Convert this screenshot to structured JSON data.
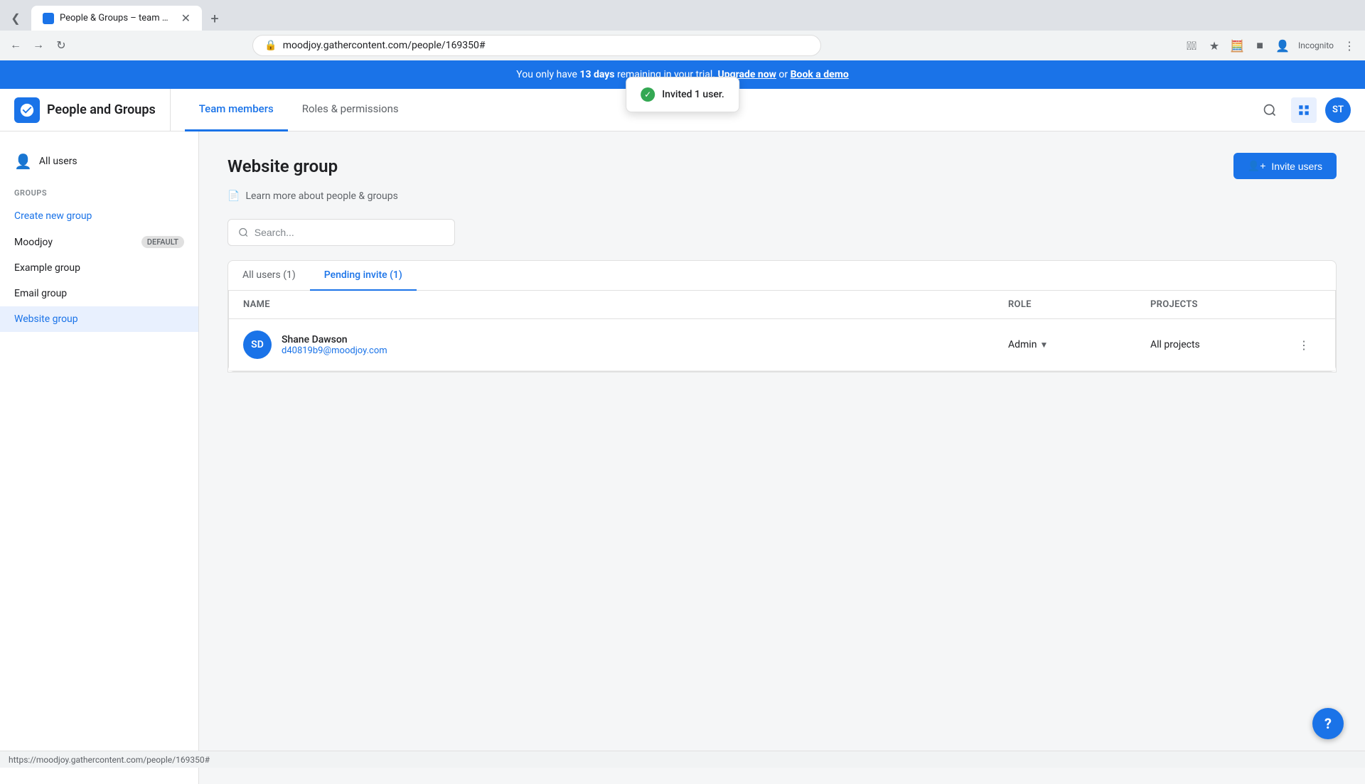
{
  "browser": {
    "tab_title": "People & Groups – team mem...",
    "url": "moodjoy.gathercontent.com/people/169350#",
    "new_tab_label": "+"
  },
  "banner": {
    "text_before": "You only have ",
    "days": "13 days",
    "text_after": " remai...",
    "upgrade_link": "Upgrade now",
    "or": " or ",
    "demo_link": "Book a demo"
  },
  "toast": {
    "message": "Invited 1 user."
  },
  "header": {
    "app_name": "People and Groups",
    "nav": {
      "team_members": "Team members",
      "roles_permissions": "Roles & permissions"
    },
    "avatar_initials": "ST"
  },
  "sidebar": {
    "all_users_label": "All users",
    "groups_section_label": "GROUPS",
    "create_new_group": "Create new group",
    "groups": [
      {
        "name": "Moodjoy",
        "badge": "DEFAULT",
        "active": false
      },
      {
        "name": "Example group",
        "badge": "",
        "active": false
      },
      {
        "name": "Email group",
        "badge": "",
        "active": false
      },
      {
        "name": "Website group",
        "badge": "",
        "active": true
      }
    ]
  },
  "content": {
    "page_title": "Website group",
    "learn_more_link": "Learn more about people & groups",
    "search_placeholder": "Search...",
    "invite_btn_label": "Invite users",
    "tabs": [
      {
        "label": "All users (1)",
        "active": false
      },
      {
        "label": "Pending invite (1)",
        "active": true
      }
    ],
    "table": {
      "columns": [
        "Name",
        "Role",
        "Projects"
      ],
      "rows": [
        {
          "initials": "SD",
          "name": "Shane Dawson",
          "email": "d40819b9@moodjoy.com",
          "role": "Admin",
          "projects": "All projects"
        }
      ]
    }
  },
  "status_bar": {
    "url": "https://moodjoy.gathercontent.com/people/169350#"
  },
  "help_btn": "?"
}
